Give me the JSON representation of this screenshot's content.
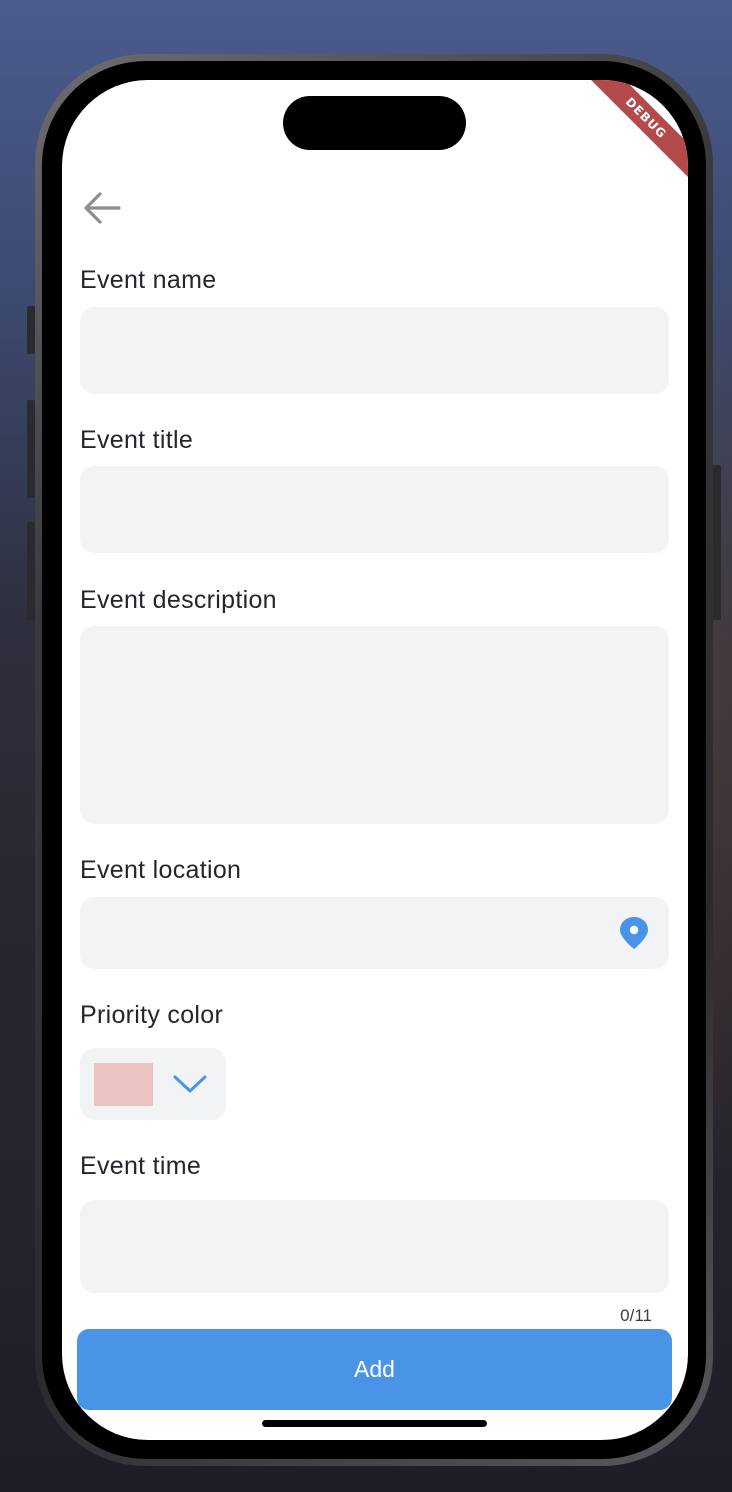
{
  "debug_banner": "DEBUG",
  "form": {
    "event_name": {
      "label": "Event name",
      "value": ""
    },
    "event_title": {
      "label": "Event title",
      "value": ""
    },
    "event_description": {
      "label": "Event description",
      "value": ""
    },
    "event_location": {
      "label": "Event location",
      "value": ""
    },
    "priority_color": {
      "label": "Priority color",
      "selected_color": "#ebc3c1"
    },
    "event_time": {
      "label": "Event time",
      "value": "",
      "counter": "0/11"
    }
  },
  "icons": {
    "back": "arrow-left-icon",
    "location": "location-pin-icon",
    "dropdown": "chevron-down-icon"
  },
  "colors": {
    "accent": "#4a94e8",
    "field_bg": "#f2f3f5",
    "debug_ribbon": "#b4494a"
  },
  "add_button": {
    "label": "Add"
  }
}
